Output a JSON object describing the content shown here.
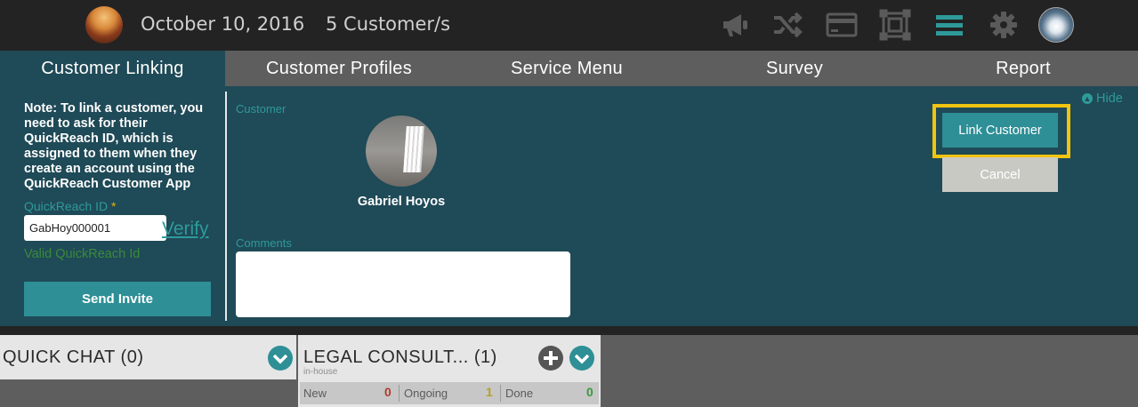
{
  "header": {
    "date": "October 10, 2016",
    "customer_count": "5 Customer/s",
    "icons": [
      "megaphone-icon",
      "shuffle-icon",
      "credit-card-icon",
      "crop-frame-icon",
      "menu-icon",
      "gear-icon",
      "user-avatar"
    ],
    "menu_icon_color": "#2e9a9a"
  },
  "nav": {
    "tabs": [
      {
        "label": "Customer Linking",
        "active": true
      },
      {
        "label": "Customer Profiles",
        "active": false
      },
      {
        "label": "Service Menu",
        "active": false
      },
      {
        "label": "Survey",
        "active": false
      },
      {
        "label": "Report",
        "active": false
      }
    ]
  },
  "linking": {
    "note": "Note: To link a customer, you need to ask for their QuickReach ID, which is assigned to them when they create an account using the QuickReach Customer App",
    "quickreach_label": "QuickReach ID",
    "required_mark": "*",
    "quickreach_value": "GabHoy000001",
    "verify_link": "Verify",
    "valid_message": "Valid QuickReach Id",
    "send_invite": "Send Invite"
  },
  "customer": {
    "section_label": "Customer",
    "name": "Gabriel Hoyos",
    "comments_label": "Comments",
    "comments_value": ""
  },
  "actions": {
    "hide": "Hide",
    "link_customer": "Link Customer",
    "cancel": "Cancel",
    "highlight_color": "#f1c40f"
  },
  "queues": {
    "quick_chat": {
      "title": "QUICK CHAT (0)"
    },
    "legal": {
      "title": "LEGAL CONSULT... (1)",
      "subtitle": "in-house",
      "stats": [
        {
          "label": "New",
          "value": "0",
          "color": "#b03a2e"
        },
        {
          "label": "Ongoing",
          "value": "1",
          "color": "#b8a020"
        },
        {
          "label": "Done",
          "value": "0",
          "color": "#3a9a3a"
        }
      ]
    }
  }
}
